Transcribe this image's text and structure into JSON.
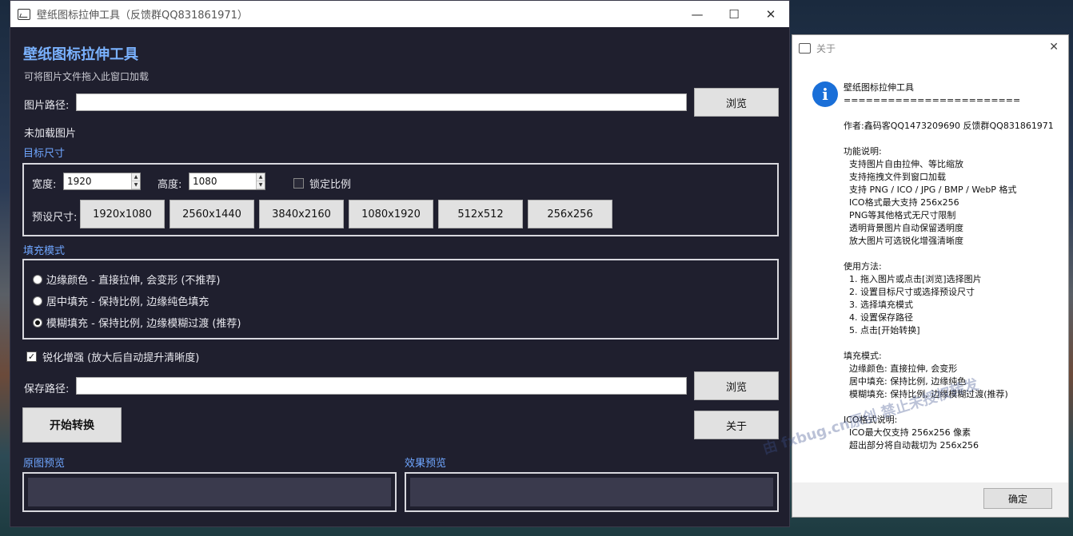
{
  "main_window": {
    "title": "壁纸图标拉伸工具（反馈群QQ831861971）",
    "controls": {
      "minimize": "—",
      "maximize": "☐",
      "close": "✕"
    },
    "heading": "壁纸图标拉伸工具",
    "subtitle": "可将图片文件拖入此窗口加载",
    "image_path": {
      "label": "图片路径:",
      "value": "",
      "browse": "浏览"
    },
    "status": "未加载图片",
    "target_size": {
      "title": "目标尺寸",
      "width_label": "宽度:",
      "width_value": "1920",
      "height_label": "高度:",
      "height_value": "1080",
      "lock_ratio_label": "锁定比例",
      "lock_ratio_checked": false,
      "preset_label": "预设尺寸:",
      "presets": [
        "1920x1080",
        "2560x1440",
        "3840x2160",
        "1080x1920",
        "512x512",
        "256x256"
      ]
    },
    "fill_mode": {
      "title": "填充模式",
      "options": [
        {
          "label": "边缘颜色 - 直接拉伸, 会变形 (不推荐)",
          "selected": false
        },
        {
          "label": "居中填充 - 保持比例, 边缘纯色填充",
          "selected": false
        },
        {
          "label": "模糊填充 - 保持比例, 边缘模糊过渡 (推荐)",
          "selected": true
        }
      ]
    },
    "sharpen": {
      "label": "锐化增强 (放大后自动提升清晰度)",
      "checked": true
    },
    "save_path": {
      "label": "保存路径:",
      "value": "",
      "browse": "浏览"
    },
    "start_button": "开始转换",
    "about_button": "关于",
    "original_preview_label": "原图预览",
    "result_preview_label": "效果预览"
  },
  "about_dialog": {
    "title": "关于",
    "close": "✕",
    "icon": "info-icon",
    "message": "壁纸图标拉伸工具\n========================\n\n作者:鑫码客QQ1473209690 反馈群QQ831861971\n\n功能说明:\n  支持图片自由拉伸、等比缩放\n  支持拖拽文件到窗口加载\n  支持 PNG / ICO / JPG / BMP / WebP 格式\n  ICO格式最大支持 256x256\n  PNG等其他格式无尺寸限制\n  透明背景图片自动保留透明度\n  放大图片可选锐化增强清晰度\n\n使用方法:\n  1. 拖入图片或点击[浏览]选择图片\n  2. 设置目标尺寸或选择预设尺寸\n  3. 选择填充模式\n  4. 设置保存路径\n  5. 点击[开始转换]\n\n填充模式:\n  边缘颜色: 直接拉伸, 会变形\n  居中填充: 保持比例, 边缘纯色\n  模糊填充: 保持比例, 边缘模糊过渡(推荐)\n\nICO格式说明:\n  ICO最大仅支持 256x256 像素\n  超出部分将自动裁切为 256x256",
    "ok_button": "确定"
  },
  "watermark": "由 fxbug.cn原创  禁止未授权转发",
  "colors": {
    "window_bg": "#1f1f2e",
    "accent_heading": "#7ab2ff",
    "section_title": "#6fa6ff",
    "info_blue": "#1a6fd8"
  }
}
